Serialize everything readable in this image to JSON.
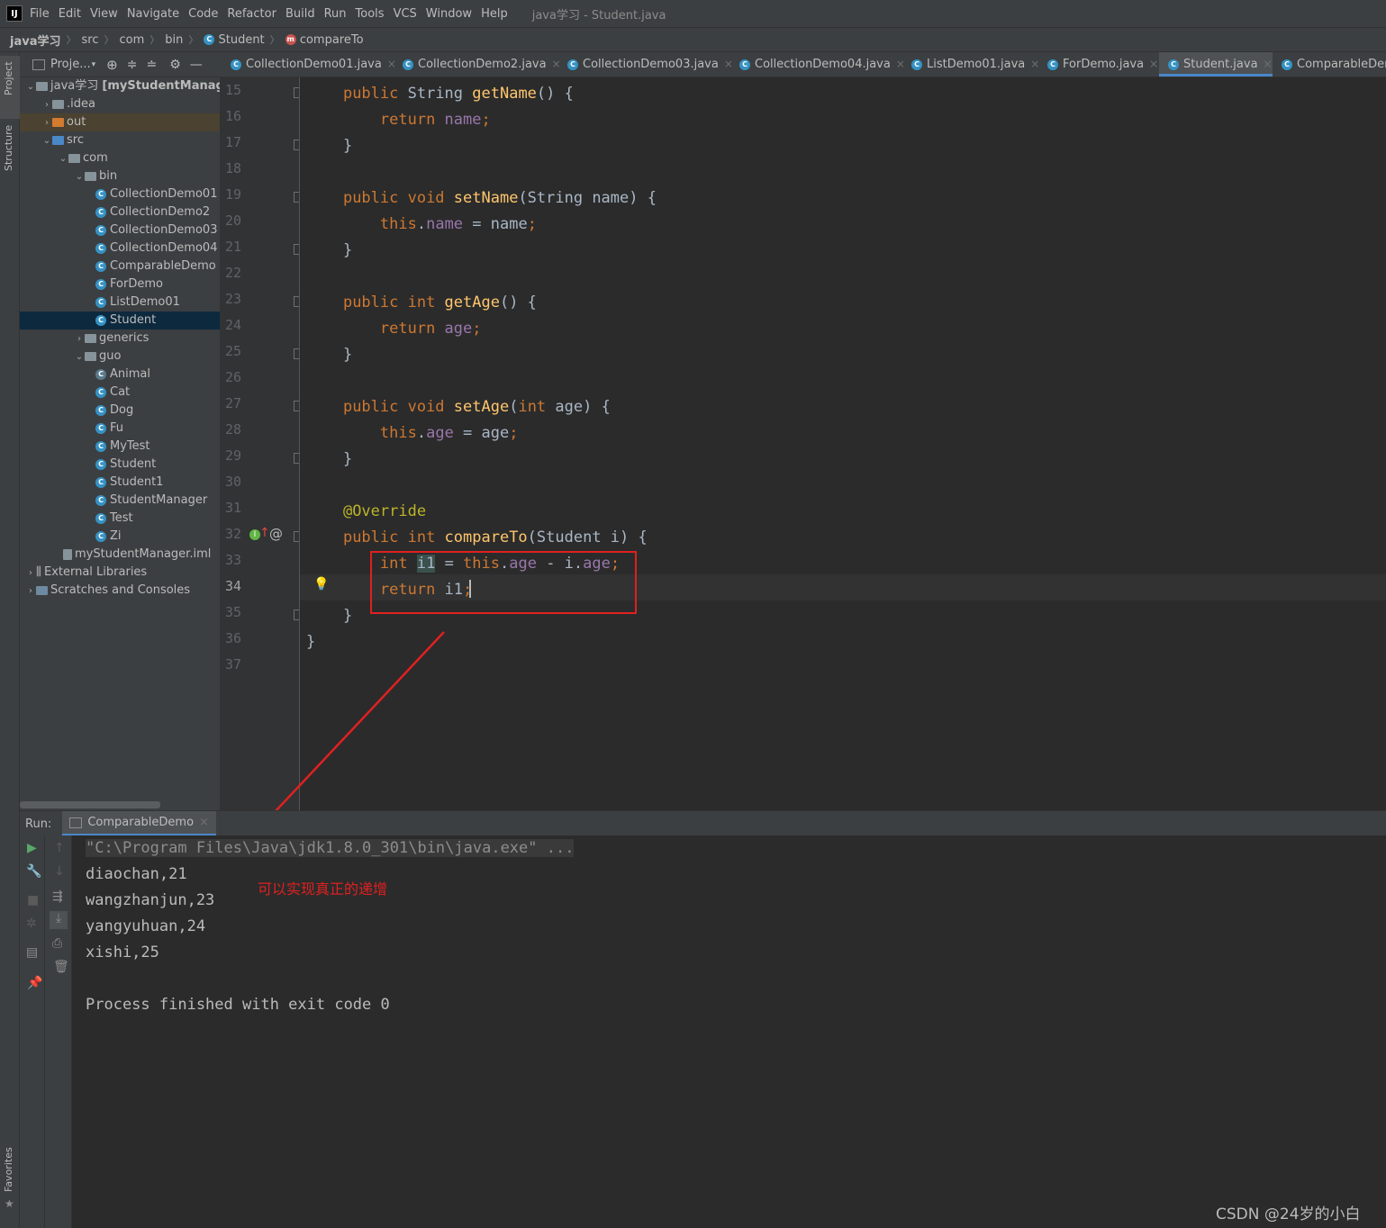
{
  "app": {
    "menu": [
      "File",
      "Edit",
      "View",
      "Navigate",
      "Code",
      "Refactor",
      "Build",
      "Run",
      "Tools",
      "VCS",
      "Window",
      "Help"
    ],
    "window_title": "java学习 - Student.java",
    "logo": "IJ"
  },
  "breadcrumb": {
    "items": [
      "java学习",
      "src",
      "com",
      "bin",
      "Student",
      "compareTo"
    ]
  },
  "left_strip": {
    "project": "Project",
    "structure": "Structure",
    "favorites": "Favorites"
  },
  "project_panel": {
    "title": "Proje...",
    "tree": [
      {
        "label": "java学习 [myStudentManager]",
        "indent": 0,
        "arrow": "v",
        "kind": "module"
      },
      {
        "label": ".idea",
        "indent": 1,
        "arrow": ">",
        "kind": "folder"
      },
      {
        "label": "out",
        "indent": 1,
        "arrow": ">",
        "kind": "folder-orange"
      },
      {
        "label": "src",
        "indent": 1,
        "arrow": "v",
        "kind": "folder-blue"
      },
      {
        "label": "com",
        "indent": 2,
        "arrow": "v",
        "kind": "package"
      },
      {
        "label": "bin",
        "indent": 3,
        "arrow": "v",
        "kind": "package"
      },
      {
        "label": "CollectionDemo01",
        "indent": 4,
        "arrow": "",
        "kind": "class"
      },
      {
        "label": "CollectionDemo2",
        "indent": 4,
        "arrow": "",
        "kind": "class"
      },
      {
        "label": "CollectionDemo03",
        "indent": 4,
        "arrow": "",
        "kind": "class"
      },
      {
        "label": "CollectionDemo04",
        "indent": 4,
        "arrow": "",
        "kind": "class"
      },
      {
        "label": "ComparableDemo",
        "indent": 4,
        "arrow": "",
        "kind": "class"
      },
      {
        "label": "ForDemo",
        "indent": 4,
        "arrow": "",
        "kind": "class"
      },
      {
        "label": "ListDemo01",
        "indent": 4,
        "arrow": "",
        "kind": "class"
      },
      {
        "label": "Student",
        "indent": 4,
        "arrow": "",
        "kind": "class",
        "selected": true
      },
      {
        "label": "generics",
        "indent": 3,
        "arrow": ">",
        "kind": "package"
      },
      {
        "label": "guo",
        "indent": 3,
        "arrow": "v",
        "kind": "package"
      },
      {
        "label": "Animal",
        "indent": 4,
        "arrow": "",
        "kind": "abstract"
      },
      {
        "label": "Cat",
        "indent": 4,
        "arrow": "",
        "kind": "class"
      },
      {
        "label": "Dog",
        "indent": 4,
        "arrow": "",
        "kind": "class"
      },
      {
        "label": "Fu",
        "indent": 4,
        "arrow": "",
        "kind": "class"
      },
      {
        "label": "MyTest",
        "indent": 4,
        "arrow": "",
        "kind": "class"
      },
      {
        "label": "Student",
        "indent": 4,
        "arrow": "",
        "kind": "class"
      },
      {
        "label": "Student1",
        "indent": 4,
        "arrow": "",
        "kind": "class"
      },
      {
        "label": "StudentManager",
        "indent": 4,
        "arrow": "",
        "kind": "class"
      },
      {
        "label": "Test",
        "indent": 4,
        "arrow": "",
        "kind": "class"
      },
      {
        "label": "Zi",
        "indent": 4,
        "arrow": "",
        "kind": "class"
      },
      {
        "label": "myStudentManager.iml",
        "indent": 2,
        "arrow": "",
        "kind": "file"
      },
      {
        "label": "External Libraries",
        "indent": 0,
        "arrow": ">",
        "kind": "lib"
      },
      {
        "label": "Scratches and Consoles",
        "indent": 0,
        "arrow": ">",
        "kind": "scratch"
      }
    ]
  },
  "tabs": [
    {
      "label": "CollectionDemo01.java",
      "active": false
    },
    {
      "label": "CollectionDemo2.java",
      "active": false
    },
    {
      "label": "CollectionDemo03.java",
      "active": false
    },
    {
      "label": "CollectionDemo04.java",
      "active": false
    },
    {
      "label": "ListDemo01.java",
      "active": false
    },
    {
      "label": "ForDemo.java",
      "active": false
    },
    {
      "label": "Student.java",
      "active": true
    },
    {
      "label": "ComparableDem",
      "active": false
    }
  ],
  "editor": {
    "current_line": "34",
    "lines": [
      {
        "n": "15",
        "tokens": [
          [
            "    ",
            ""
          ],
          [
            "public ",
            "kw"
          ],
          [
            "String ",
            ""
          ],
          [
            "getName",
            "fn"
          ],
          [
            "() {",
            ""
          ]
        ]
      },
      {
        "n": "16",
        "tokens": [
          [
            "        ",
            ""
          ],
          [
            "return ",
            "kw"
          ],
          [
            "name",
            "fld"
          ],
          [
            ";",
            "kw"
          ]
        ]
      },
      {
        "n": "17",
        "tokens": [
          [
            "    }",
            ""
          ]
        ]
      },
      {
        "n": "18",
        "tokens": []
      },
      {
        "n": "19",
        "tokens": [
          [
            "    ",
            ""
          ],
          [
            "public void ",
            "kw"
          ],
          [
            "setName",
            "fn"
          ],
          [
            "(String name) {",
            ""
          ]
        ]
      },
      {
        "n": "20",
        "tokens": [
          [
            "        ",
            ""
          ],
          [
            "this",
            "kw"
          ],
          [
            ".",
            ""
          ],
          [
            "name",
            "fld"
          ],
          [
            " = name",
            ""
          ],
          [
            ";",
            "kw"
          ]
        ]
      },
      {
        "n": "21",
        "tokens": [
          [
            "    }",
            ""
          ]
        ]
      },
      {
        "n": "22",
        "tokens": []
      },
      {
        "n": "23",
        "tokens": [
          [
            "    ",
            ""
          ],
          [
            "public int ",
            "kw"
          ],
          [
            "getAge",
            "fn"
          ],
          [
            "() {",
            ""
          ]
        ]
      },
      {
        "n": "24",
        "tokens": [
          [
            "        ",
            ""
          ],
          [
            "return ",
            "kw"
          ],
          [
            "age",
            "fld"
          ],
          [
            ";",
            "kw"
          ]
        ]
      },
      {
        "n": "25",
        "tokens": [
          [
            "    }",
            ""
          ]
        ]
      },
      {
        "n": "26",
        "tokens": []
      },
      {
        "n": "27",
        "tokens": [
          [
            "    ",
            ""
          ],
          [
            "public void ",
            "kw"
          ],
          [
            "setAge",
            "fn"
          ],
          [
            "(",
            ""
          ],
          [
            "int ",
            "kw"
          ],
          [
            "age) {",
            ""
          ]
        ]
      },
      {
        "n": "28",
        "tokens": [
          [
            "        ",
            ""
          ],
          [
            "this",
            "kw"
          ],
          [
            ".",
            ""
          ],
          [
            "age",
            "fld"
          ],
          [
            " = age",
            ""
          ],
          [
            ";",
            "kw"
          ]
        ]
      },
      {
        "n": "29",
        "tokens": [
          [
            "    }",
            ""
          ]
        ]
      },
      {
        "n": "30",
        "tokens": []
      },
      {
        "n": "31",
        "tokens": [
          [
            "    ",
            ""
          ],
          [
            "@Override",
            "ann"
          ]
        ]
      },
      {
        "n": "32",
        "tokens": [
          [
            "    ",
            ""
          ],
          [
            "public int ",
            "kw"
          ],
          [
            "compareTo",
            "fn"
          ],
          [
            "(Student i) {",
            ""
          ]
        ]
      },
      {
        "n": "33",
        "tokens": [
          [
            "        ",
            ""
          ],
          [
            "int ",
            "kw"
          ],
          [
            "i1",
            "hl"
          ],
          [
            " = ",
            ""
          ],
          [
            "this",
            "kw"
          ],
          [
            ".",
            ""
          ],
          [
            "age",
            "fld"
          ],
          [
            " - i.",
            ""
          ],
          [
            "age",
            "fld"
          ],
          [
            ";",
            "kw"
          ]
        ]
      },
      {
        "n": "34",
        "tokens": [
          [
            "        ",
            ""
          ],
          [
            "return ",
            "kw"
          ],
          [
            "i1",
            ""
          ],
          [
            ";",
            "kw"
          ]
        ]
      },
      {
        "n": "35",
        "tokens": [
          [
            "    }",
            ""
          ]
        ]
      },
      {
        "n": "36",
        "tokens": [
          [
            "}",
            ""
          ]
        ]
      },
      {
        "n": "37",
        "tokens": []
      }
    ]
  },
  "run_panel": {
    "label": "Run:",
    "tab": "ComparableDemo",
    "output": [
      "\"C:\\Program Files\\Java\\jdk1.8.0_301\\bin\\java.exe\" ...",
      "diaochan,21",
      "wangzhanjun,23",
      "yangyuhuan,24",
      "xishi,25",
      "",
      "Process finished with exit code 0"
    ]
  },
  "annotation": {
    "text": "可以实现真正的递增",
    "color": "#e02020"
  },
  "watermark": "CSDN @24岁的小白",
  "colors": {
    "keyword": "#cc7832",
    "function": "#ffc66d",
    "field": "#9876aa",
    "annotation": "#bbb529",
    "accent": "#4a88c7"
  }
}
